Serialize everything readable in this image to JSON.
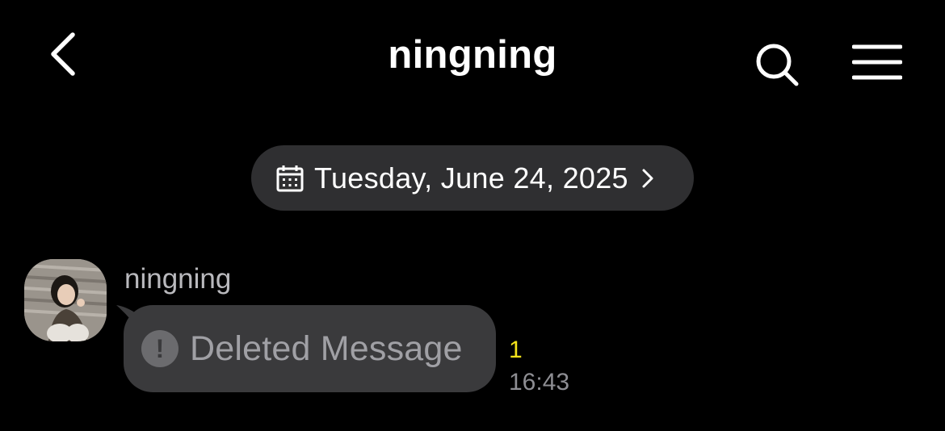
{
  "header": {
    "title": "ningning",
    "back_icon": "chevron-left-icon",
    "search_icon": "search-icon",
    "menu_icon": "menu-icon"
  },
  "date_separator": {
    "label": "Tuesday, June 24, 2025",
    "icon": "calendar-icon",
    "chevron_icon": "chevron-right-icon"
  },
  "message": {
    "sender": "ningning",
    "text": "Deleted Message",
    "status_icon": "exclamation-circle-icon",
    "unread_count": "1",
    "time": "16:43",
    "unread_color": "#f5e31a"
  },
  "colors": {
    "background": "#000000",
    "bubble": "#3a3a3c",
    "pill": "#2f2f31"
  }
}
